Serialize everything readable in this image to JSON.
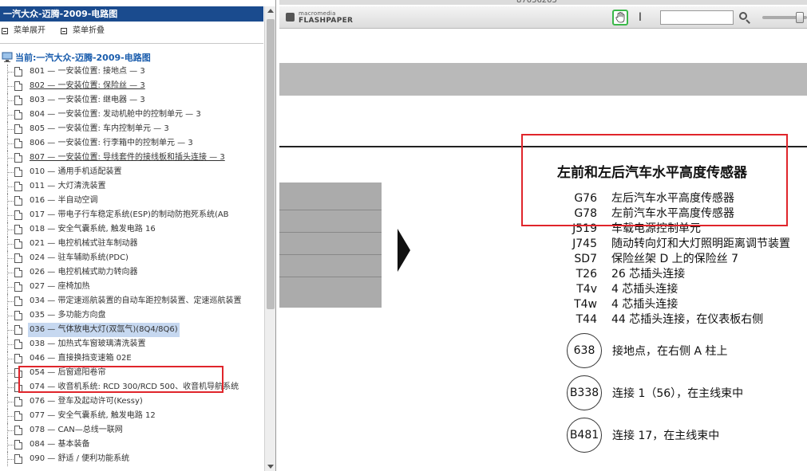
{
  "left_pane": {
    "title": "一汽大众-迈腾-2009-电路图",
    "toolbar": {
      "expand_label": "菜单展开",
      "collapse_label": "菜单折叠"
    },
    "tree": {
      "root_label": "当前:一汽大众-迈腾-2009-电路图",
      "items": [
        {
          "label": "801 — 一安装位置: 接地点 — 3"
        },
        {
          "label": "802 — 一安装位置: 保险丝 — 3"
        },
        {
          "label": "803 — 一安装位置: 继电器 — 3"
        },
        {
          "label": "804 — 一安装位置: 发动机舱中的控制单元 — 3"
        },
        {
          "label": "805 — 一安装位置: 车内控制单元 — 3"
        },
        {
          "label": "806 — 一安装位置: 行李箱中的控制单元 — 3"
        },
        {
          "label": "807 — 一安装位置: 导线套件的接线板和插头连接 — 3"
        },
        {
          "label": "010 — 通用手机适配装置"
        },
        {
          "label": "011 — 大灯清洗装置"
        },
        {
          "label": "016 — 半自动空调"
        },
        {
          "label": "017 — 带电子行车稳定系统(ESP)的制动防抱死系统(AB"
        },
        {
          "label": "018 — 安全气囊系统, 触发电路 16"
        },
        {
          "label": "021 — 电控机械式驻车制动器"
        },
        {
          "label": "024 — 驻车辅助系统(PDC)"
        },
        {
          "label": "026 — 电控机械式助力转向器"
        },
        {
          "label": "027 — 座椅加热"
        },
        {
          "label": "034 — 带定速巡航装置的自动车距控制装置、定速巡航装置"
        },
        {
          "label": "035 — 多功能方向盘"
        },
        {
          "label": "036 — 气体放电大灯(双氙气)(8Q4/8Q6)"
        },
        {
          "label": "038 — 加热式车窗玻璃清洗装置"
        },
        {
          "label": "046 — 直接换挡变速箱 02E"
        },
        {
          "label": "054 — 后窗遮阳卷帘"
        },
        {
          "label": "074 — 收音机系统: RCD 300/RCD 500、收音机导航系统"
        },
        {
          "label": "076 — 登车及起动许可(Kessy)"
        },
        {
          "label": "077 — 安全气囊系统, 触发电路 12"
        },
        {
          "label": "078 — CAN—总线一联网"
        },
        {
          "label": "084 — 基本装备"
        },
        {
          "label": "090 — 舒适 / 便利功能系统"
        }
      ]
    }
  },
  "viewer": {
    "top_strip_text": "87056205",
    "brand": {
      "small": "macromedia",
      "big": "FLASHPAPER"
    },
    "tools": {
      "hand_icon": "hand-icon",
      "text_icon": "text-cursor-icon",
      "search_icon": "magnifier-icon"
    },
    "search_placeholder": "",
    "legend": {
      "title": "左前和左后汽车水平高度传感器",
      "rows": [
        {
          "code": "G76",
          "desc": "左后汽车水平高度传感器"
        },
        {
          "code": "G78",
          "desc": "左前汽车水平高度传感器"
        },
        {
          "code": "J519",
          "desc": "车载电源控制单元"
        },
        {
          "code": "J745",
          "desc": "随动转向灯和大灯照明距离调节装置"
        },
        {
          "code": "SD7",
          "desc": "保险丝架 D 上的保险丝 7"
        },
        {
          "code": "T26",
          "desc": "26 芯插头连接"
        },
        {
          "code": "T4v",
          "desc": "4 芯插头连接"
        },
        {
          "code": "T4w",
          "desc": "4 芯插头连接"
        },
        {
          "code": "T44",
          "desc": "44 芯插头连接，在仪表板右侧"
        }
      ],
      "circles": [
        {
          "code": "638",
          "desc": "接地点，在右侧 A 柱上"
        },
        {
          "code": "B338",
          "desc": "连接 1（56），在主线束中"
        },
        {
          "code": "B481",
          "desc": "连接 17，在主线束中"
        }
      ]
    }
  },
  "colors": {
    "title_bar": "#1a4b8e",
    "tree_root_text": "#1a5dad",
    "highlight_box": "#e0252b",
    "hand_tool_border": "#3bb84a"
  }
}
